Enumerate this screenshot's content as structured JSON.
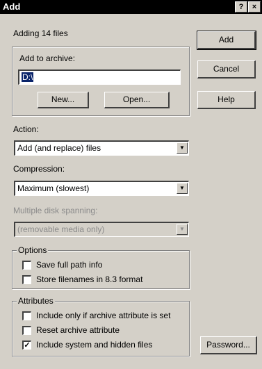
{
  "window": {
    "title": "Add",
    "help_glyph": "?",
    "close_glyph": "×"
  },
  "status": "Adding 14 files",
  "archive": {
    "group_label": "Add to archive:",
    "path_value": "D:\\",
    "new_label": "New...",
    "open_label": "Open..."
  },
  "buttons": {
    "add": "Add",
    "cancel": "Cancel",
    "help": "Help",
    "password": "Password..."
  },
  "action": {
    "label": "Action:",
    "value": "Add (and replace) files"
  },
  "compression": {
    "label": "Compression:",
    "value": "Maximum (slowest)"
  },
  "spanning": {
    "label": "Multiple disk spanning:",
    "value": "(removable media only)",
    "enabled": false
  },
  "options": {
    "group_label": "Options",
    "items": [
      {
        "label": "Save full path info",
        "checked": false
      },
      {
        "label": "Store filenames in 8.3 format",
        "checked": false
      }
    ]
  },
  "attributes": {
    "group_label": "Attributes",
    "items": [
      {
        "label": "Include only if archive attribute is set",
        "checked": false
      },
      {
        "label": "Reset archive attribute",
        "checked": false
      },
      {
        "label": "Include system and hidden files",
        "checked": true
      }
    ]
  },
  "glyphs": {
    "dropdown_arrow": "▼",
    "check_mark": "✓"
  },
  "colors": {
    "titlebar": "#000000",
    "dialog_bg": "#d4d0c8",
    "selection": "#0a246a"
  }
}
